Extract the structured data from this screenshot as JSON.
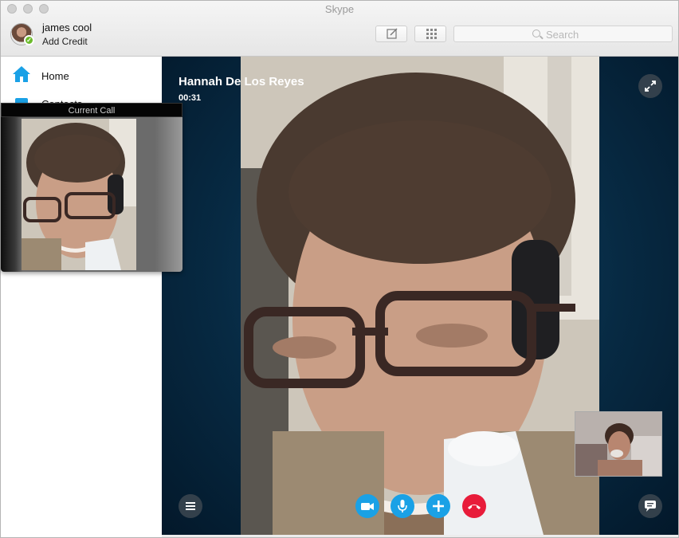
{
  "window": {
    "title": "Skype"
  },
  "profile": {
    "name": "james cool",
    "credit_link": "Add Credit"
  },
  "toolbar": {
    "search_placeholder": "Search"
  },
  "sidebar": {
    "items": [
      {
        "label": "Home"
      },
      {
        "label": "Contacts"
      }
    ]
  },
  "call": {
    "caller": "Hannah De Los Reyes",
    "duration": "00:31"
  },
  "mini_window": {
    "title": "Current Call"
  },
  "colors": {
    "accent": "#1aa1e6",
    "hangup": "#e81c3a",
    "online": "#6cbb2c"
  }
}
